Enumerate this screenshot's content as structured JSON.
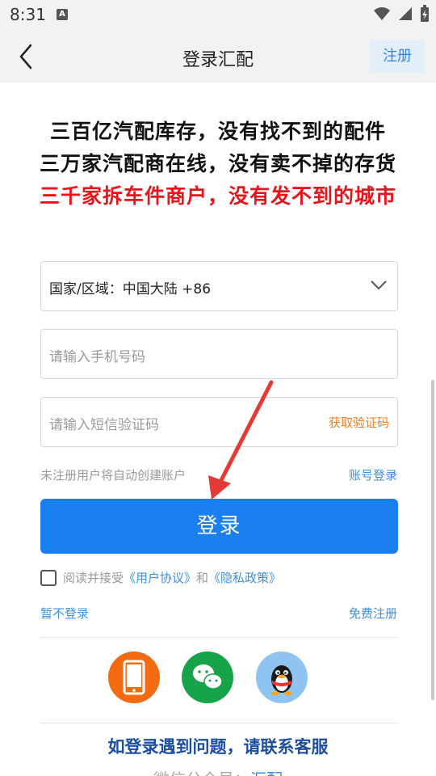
{
  "status_bar": {
    "time": "8:31",
    "notification_letter": "A"
  },
  "header": {
    "title": "登录汇配",
    "register_label": "注册"
  },
  "slogans": [
    "三百亿汽配库存，没有找不到的配件",
    "三万家汽配商在线，没有卖不掉的存货",
    "三千家拆车件商户，没有发不到的城市"
  ],
  "form": {
    "region_value": "国家/区域：中国大陆 +86",
    "phone_placeholder": "请输入手机号码",
    "sms_placeholder": "请输入短信验证码",
    "get_code_label": "获取验证码"
  },
  "hint": "未注册用户将自动创建账户",
  "account_login": "账号登录",
  "login_label": "登录",
  "agreement": {
    "prefix": "阅读并接受",
    "user_agreement": "《用户协议》",
    "and": "和",
    "privacy_policy": "《隐私政策》"
  },
  "skip_login": "暂不登录",
  "free_register": "免费注册",
  "social_icons": [
    "phone-icon",
    "wechat-icon",
    "qq-icon"
  ],
  "contact": "如登录遇到问题，请联系客服",
  "wechat_line": {
    "label": "微信公众号：",
    "account": "汇配"
  },
  "colors": {
    "primary": "#1a7ff0",
    "link": "#3d8fe0",
    "warning": "#f07d21",
    "slogan_red": "#e8141b",
    "contact": "#1b4fa2"
  }
}
